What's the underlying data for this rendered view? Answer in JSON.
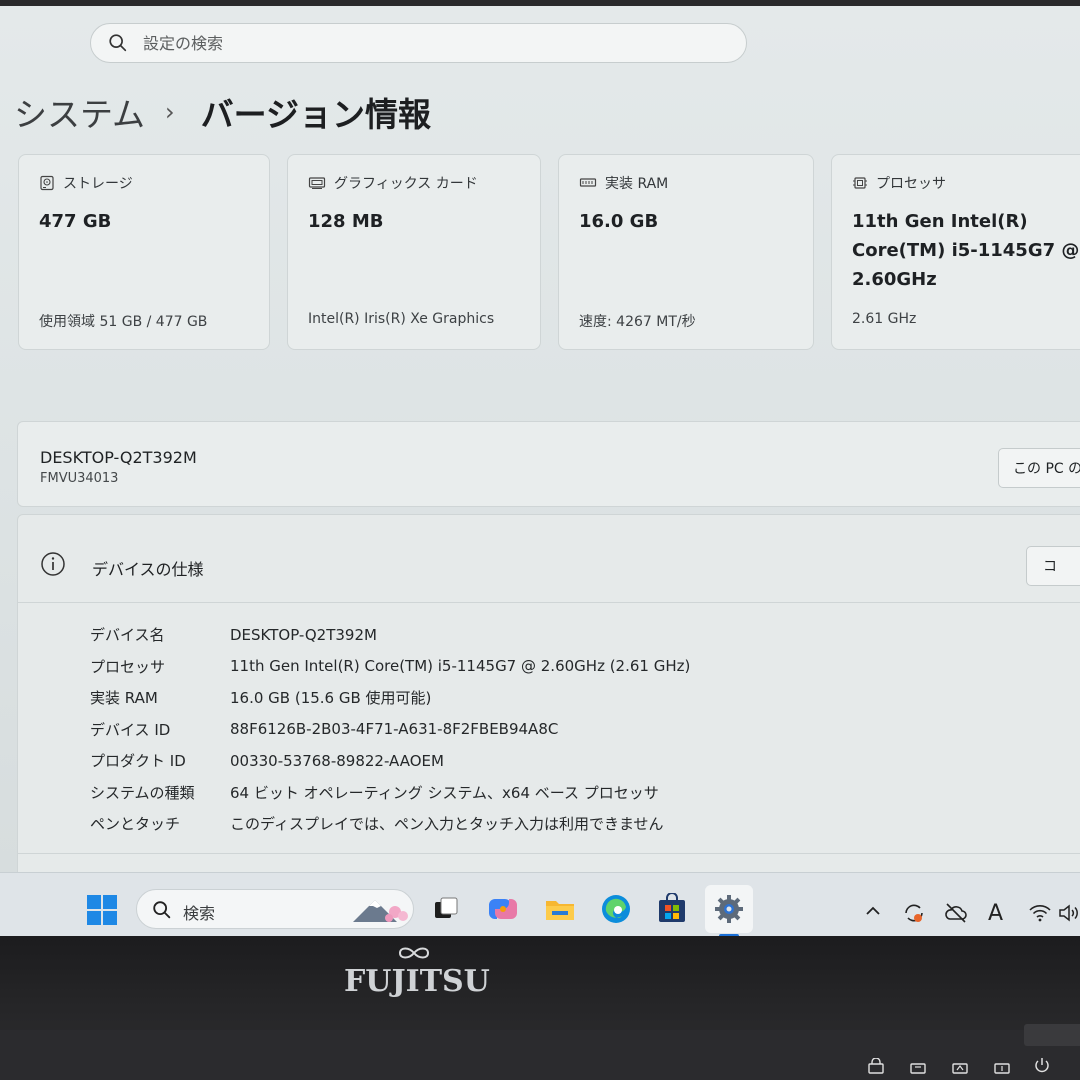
{
  "search": {
    "placeholder": "設定の検索"
  },
  "breadcrumb": {
    "parent": "システム",
    "separator": "›",
    "current": "バージョン情報"
  },
  "cards": [
    {
      "label": "ストレージ",
      "value": "477 GB",
      "sub": "使用領域 51 GB / 477 GB",
      "icon": "storage-icon"
    },
    {
      "label": "グラフィックス カード",
      "value": "128 MB",
      "sub": "Intel(R) Iris(R) Xe Graphics",
      "icon": "graphics-card-icon"
    },
    {
      "label": "実装 RAM",
      "value": "16.0 GB",
      "sub": "速度: 4267 MT/秒",
      "icon": "ram-icon"
    },
    {
      "label": "プロセッサ",
      "value": "11th Gen Intel(R) Core(TM) i5-1145G7 @ 2.60GHz",
      "sub": "2.61 GHz",
      "icon": "processor-icon"
    }
  ],
  "pc": {
    "name": "DESKTOP-Q2T392M",
    "model": "FMVU34013",
    "rename_label": "この PC の"
  },
  "spec": {
    "title": "デバイスの仕様",
    "copy_label": "コ",
    "rows": [
      {
        "key": "デバイス名",
        "value": "DESKTOP-Q2T392M"
      },
      {
        "key": "プロセッサ",
        "value": "11th Gen Intel(R) Core(TM) i5-1145G7 @ 2.60GHz (2.61 GHz)"
      },
      {
        "key": "実装 RAM",
        "value": "16.0 GB (15.6 GB 使用可能)"
      },
      {
        "key": "デバイス ID",
        "value": "88F6126B-2B03-4F71-A631-8F2FBEB94A8C"
      },
      {
        "key": "プロダクト ID",
        "value": "00330-53768-89822-AAOEM"
      },
      {
        "key": "システムの種類",
        "value": "64 ビット オペレーティング システム、x64 ベース プロセッサ"
      },
      {
        "key": "ペンとタッチ",
        "value": "このディスプレイでは、ペン入力とタッチ入力は利用できません"
      }
    ]
  },
  "taskbar": {
    "search_text": "検索",
    "apps": [
      "task-view-icon",
      "copilot-icon",
      "file-explorer-icon",
      "edge-icon",
      "store-icon",
      "settings-icon"
    ],
    "tray_ime": "A"
  },
  "bezel": {
    "brand": "FUJITSU"
  },
  "colors": {
    "accent": "#1a6fd6",
    "windows_blue": "#1e88e5"
  }
}
